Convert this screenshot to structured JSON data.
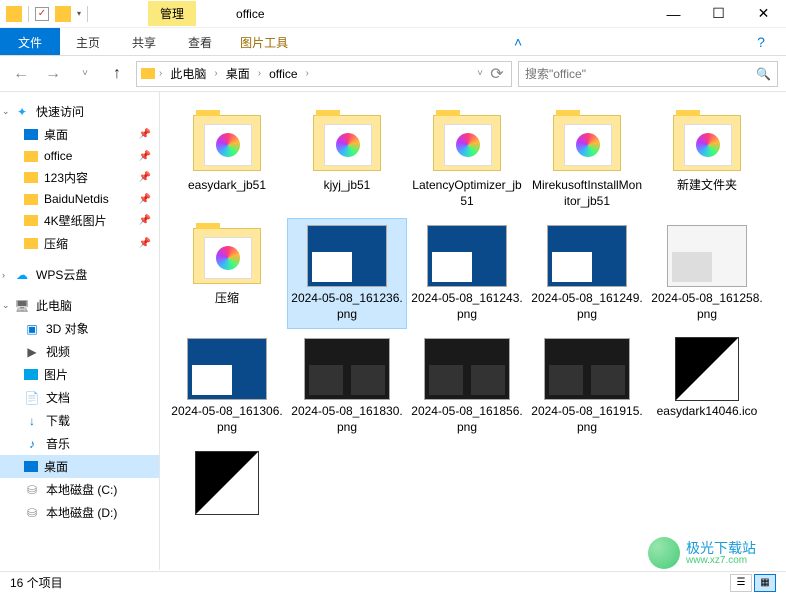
{
  "window": {
    "title": "office",
    "ribbon_context": "管理",
    "context_sub": "图片工具"
  },
  "ribbon": {
    "file": "文件",
    "tabs": [
      "主页",
      "共享",
      "查看"
    ]
  },
  "breadcrumb": {
    "segments": [
      "此电脑",
      "桌面",
      "office"
    ]
  },
  "search": {
    "placeholder": "搜索\"office\""
  },
  "sidebar": {
    "quick_access": "快速访问",
    "pinned": [
      {
        "label": "桌面",
        "icon": "desk"
      },
      {
        "label": "office",
        "icon": "folder"
      },
      {
        "label": "123内容",
        "icon": "folder"
      },
      {
        "label": "BaiduNetdis",
        "icon": "folder"
      },
      {
        "label": "4K壁纸图片",
        "icon": "folder"
      },
      {
        "label": "压缩",
        "icon": "folder"
      }
    ],
    "wps": "WPS云盘",
    "this_pc": "此电脑",
    "pc_items": [
      {
        "label": "3D 对象",
        "icon": "3d"
      },
      {
        "label": "视频",
        "icon": "vid"
      },
      {
        "label": "图片",
        "icon": "pic"
      },
      {
        "label": "文档",
        "icon": "doc"
      },
      {
        "label": "下载",
        "icon": "dl"
      },
      {
        "label": "音乐",
        "icon": "mus"
      },
      {
        "label": "桌面",
        "icon": "desk",
        "selected": true
      },
      {
        "label": "本地磁盘 (C:)",
        "icon": "disk"
      },
      {
        "label": "本地磁盘 (D:)",
        "icon": "disk"
      }
    ]
  },
  "items": [
    {
      "name": "easydark_jb51",
      "type": "folder-app"
    },
    {
      "name": "kjyj_jb51",
      "type": "folder-app"
    },
    {
      "name": "LatencyOptimizer_jb51",
      "type": "folder-app"
    },
    {
      "name": "MirekusoftInstallMonitor_jb51",
      "type": "folder-app"
    },
    {
      "name": "新建文件夹",
      "type": "folder-app"
    },
    {
      "name": "压缩",
      "type": "folder-app"
    },
    {
      "name": "2024-05-08_161236.png",
      "type": "img-blue",
      "selected": true
    },
    {
      "name": "2024-05-08_161243.png",
      "type": "img-blue"
    },
    {
      "name": "2024-05-08_161249.png",
      "type": "img-blue"
    },
    {
      "name": "2024-05-08_161258.png",
      "type": "img-white"
    },
    {
      "name": "2024-05-08_161306.png",
      "type": "img-blue"
    },
    {
      "name": "2024-05-08_161830.png",
      "type": "img-dark"
    },
    {
      "name": "2024-05-08_161856.png",
      "type": "img-dark"
    },
    {
      "name": "2024-05-08_161915.png",
      "type": "img-dark"
    },
    {
      "name": "easydark14046.ico",
      "type": "ico"
    },
    {
      "name": "",
      "type": "ico-partial"
    }
  ],
  "status": {
    "count": "16 个项目"
  },
  "watermark": {
    "title": "极光下载站",
    "url": "www.xz7.com"
  }
}
